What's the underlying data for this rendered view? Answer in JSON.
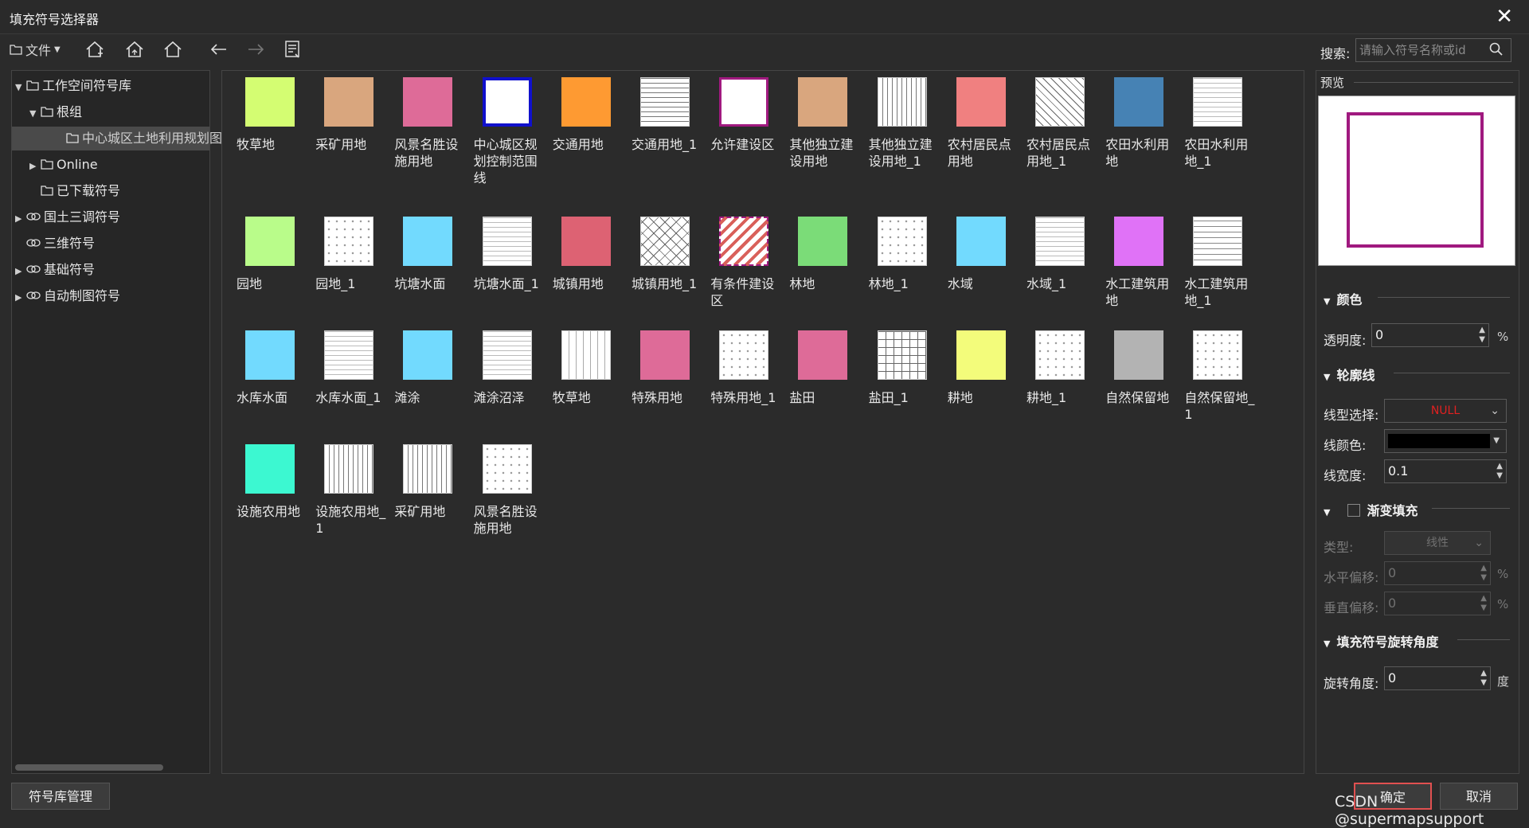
{
  "window": {
    "title": "填充符号选择器"
  },
  "toolbar": {
    "file_label": "文件",
    "search_label": "搜索:",
    "search_placeholder": "请输入符号名称或id"
  },
  "tree": {
    "items": [
      {
        "label": "工作空间符号库",
        "level": 0,
        "expanded": true,
        "icon": "folder-icon"
      },
      {
        "label": "根组",
        "level": 1,
        "expanded": true,
        "icon": "folder-icon"
      },
      {
        "label": "中心城区土地利用规划图",
        "level": 2,
        "selected": true,
        "icon": "folder-icon"
      },
      {
        "label": "Online",
        "level": 1,
        "expanded": false,
        "icon": "folder-icon"
      },
      {
        "label": "已下载符号",
        "level": 1,
        "icon": "folder-icon"
      },
      {
        "label": "国土三调符号",
        "level": 0,
        "expanded": false,
        "icon": "link-icon"
      },
      {
        "label": "三维符号",
        "level": 0,
        "icon": "link-icon"
      },
      {
        "label": "基础符号",
        "level": 0,
        "expanded": false,
        "icon": "link-icon"
      },
      {
        "label": "自动制图符号",
        "level": 0,
        "expanded": false,
        "icon": "link-icon"
      }
    ]
  },
  "symbols": [
    {
      "label": "牧草地",
      "color": "#d4fd72",
      "pattern": "solid"
    },
    {
      "label": "采矿用地",
      "color": "#d9a67e",
      "pattern": "solid"
    },
    {
      "label": "风景名胜设施用地",
      "color": "#de6b98",
      "pattern": "solid"
    },
    {
      "label": "中心城区规划控制范围线",
      "color": "#ffffff",
      "pattern": "outline-blue"
    },
    {
      "label": "交通用地",
      "color": "#fe9a32",
      "pattern": "solid"
    },
    {
      "label": "交通用地_1",
      "color": "#ffffff",
      "pattern": "hlines"
    },
    {
      "label": "允许建设区",
      "color": "#ffffff",
      "pattern": "outline-purple"
    },
    {
      "label": "其他独立建设用地",
      "color": "#d9a67e",
      "pattern": "solid"
    },
    {
      "label": "其他独立建设用地_1",
      "color": "#ffffff",
      "pattern": "vlines"
    },
    {
      "label": "农村居民点用地",
      "color": "#f08080",
      "pattern": "solid"
    },
    {
      "label": "农村居民点用地_1",
      "color": "#ffffff",
      "pattern": "diag"
    },
    {
      "label": "农田水利用地",
      "color": "#4682b4",
      "pattern": "solid"
    },
    {
      "label": "农田水利用地_1",
      "color": "#ffffff",
      "pattern": "dash"
    },
    {
      "label": "园地",
      "color": "#b9fc8a",
      "pattern": "solid"
    },
    {
      "label": "园地_1",
      "color": "#ffffff",
      "pattern": "dots"
    },
    {
      "label": "坑塘水面",
      "color": "#72dafe",
      "pattern": "solid"
    },
    {
      "label": "坑塘水面_1",
      "color": "#ffffff",
      "pattern": "dash"
    },
    {
      "label": "城镇用地",
      "color": "#dd6273",
      "pattern": "solid"
    },
    {
      "label": "城镇用地_1",
      "color": "#ffffff",
      "pattern": "cross"
    },
    {
      "label": "有条件建设区",
      "color": "#ffffff",
      "pattern": "redstripe"
    },
    {
      "label": "林地",
      "color": "#7bdc78",
      "pattern": "solid"
    },
    {
      "label": "林地_1",
      "color": "#ffffff",
      "pattern": "dots"
    },
    {
      "label": "水域",
      "color": "#72dafe",
      "pattern": "solid"
    },
    {
      "label": "水域_1",
      "color": "#ffffff",
      "pattern": "dash"
    },
    {
      "label": "水工建筑用地",
      "color": "#e072f7",
      "pattern": "solid"
    },
    {
      "label": "水工建筑用地_1",
      "color": "#ffffff",
      "pattern": "dashlines"
    },
    {
      "label": "水库水面",
      "color": "#72dafe",
      "pattern": "solid"
    },
    {
      "label": "水库水面_1",
      "color": "#ffffff",
      "pattern": "dash"
    },
    {
      "label": "滩涂",
      "color": "#72dafe",
      "pattern": "solid"
    },
    {
      "label": "滩涂沼泽",
      "color": "#ffffff",
      "pattern": "dash"
    },
    {
      "label": "牧草地",
      "color": "#ffffff",
      "pattern": "ticks"
    },
    {
      "label": "特殊用地",
      "color": "#de6b98",
      "pattern": "solid"
    },
    {
      "label": "特殊用地_1",
      "color": "#ffffff",
      "pattern": "dots"
    },
    {
      "label": "盐田",
      "color": "#de6b98",
      "pattern": "solid"
    },
    {
      "label": "盐田_1",
      "color": "#ffffff",
      "pattern": "grid"
    },
    {
      "label": "耕地",
      "color": "#f3fc7b",
      "pattern": "solid"
    },
    {
      "label": "耕地_1",
      "color": "#ffffff",
      "pattern": "dots"
    },
    {
      "label": "自然保留地",
      "color": "#b3b3b3",
      "pattern": "solid"
    },
    {
      "label": "自然保留地_1",
      "color": "#ffffff",
      "pattern": "dots"
    },
    {
      "label": "设施农用地",
      "color": "#3cf8d1",
      "pattern": "solid"
    },
    {
      "label": "设施农用地_1",
      "color": "#ffffff",
      "pattern": "vlines"
    },
    {
      "label": "采矿用地",
      "color": "#ffffff",
      "pattern": "vlines"
    },
    {
      "label": "风景名胜设施用地",
      "color": "#ffffff",
      "pattern": "dots"
    }
  ],
  "preview": {
    "label": "预览",
    "stroke_color": "#a0197f"
  },
  "props": {
    "color_section": "颜色",
    "opacity_label": "透明度:",
    "opacity_value": "0",
    "percent": "%",
    "outline_section": "轮廓线",
    "line_type_label": "线型选择:",
    "line_type_value": "NULL",
    "line_color_label": "线颜色:",
    "line_color": "#000000",
    "line_width_label": "线宽度:",
    "line_width_value": "0.1",
    "gradient_section": "渐变填充",
    "type_label": "类型:",
    "type_value": "线性",
    "h_offset_label": "水平偏移:",
    "h_offset_value": "0",
    "v_offset_label": "垂直偏移:",
    "v_offset_value": "0",
    "rotation_section": "填充符号旋转角度",
    "rotation_label": "旋转角度:",
    "rotation_value": "0",
    "degree": "度"
  },
  "footer": {
    "manage_label": "符号库管理",
    "ok_label": "确定",
    "cancel_label": "取消",
    "watermark": "CSDN @supermapsupport"
  }
}
